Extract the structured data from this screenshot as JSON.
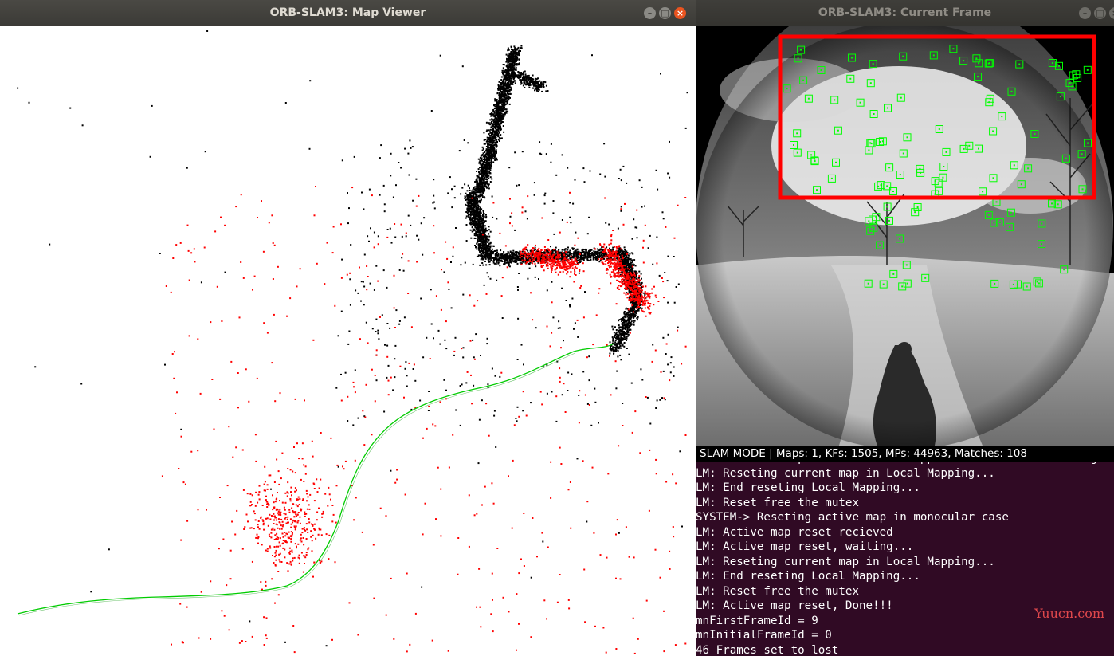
{
  "map_viewer": {
    "title": "ORB-SLAM3: Map Viewer",
    "controls": {
      "minimize": "–",
      "maximize": "□",
      "close": "×"
    }
  },
  "current_frame": {
    "title": "ORB-SLAM3: Current Frame",
    "status_bar": "SLAM MODE |  Maps: 1, KFs: 1505, MPs: 44963, Matches: 108",
    "colors": {
      "feature": "#00ff00",
      "highlight_box": "#ff0000"
    }
  },
  "terminal": {
    "lines": [
      "TRACK: Reset map because local mapper set the bad init flag",
      "LM: Reseting current map in Local Mapping...",
      "LM: End reseting Local Mapping...",
      "LM: Reset free the mutex",
      "SYSTEM-> Reseting active map in monocular case",
      "LM: Active map reset recieved",
      "LM: Active map reset, waiting...",
      "LM: Reseting current map in Local Mapping...",
      "LM: End reseting Local Mapping...",
      "LM: Reset free the mutex",
      "LM: Active map reset, Done!!!",
      "mnFirstFrameId = 9",
      "mnInitialFrameId = 0",
      "46 Frames set to lost"
    ],
    "background": "#300a24"
  },
  "watermark": "Yuucn.com",
  "map_colors": {
    "points": "#000000",
    "local_points": "#ff0000",
    "trajectory": "#00cc00"
  }
}
